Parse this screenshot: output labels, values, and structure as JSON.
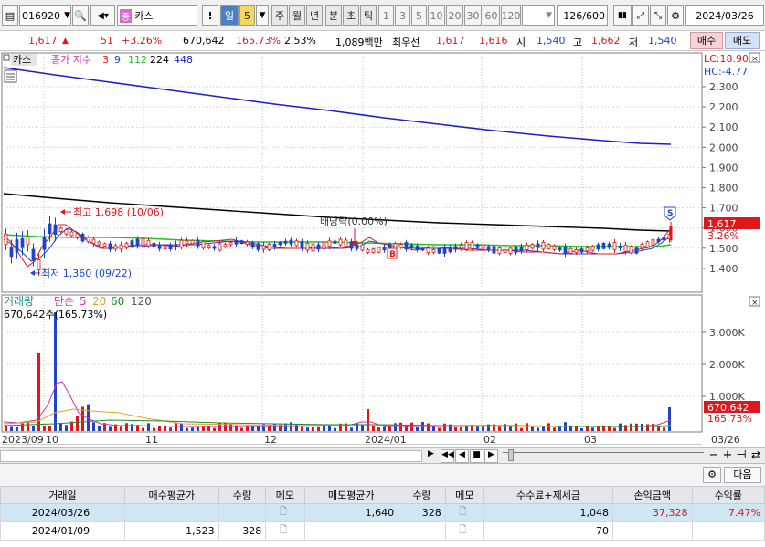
{
  "toolbar": {
    "code": "016920",
    "badge": "종",
    "name": "카스",
    "periods": [
      "일",
      "5",
      "주",
      "월",
      "년",
      "분",
      "초",
      "틱"
    ],
    "intervals": [
      "1",
      "3",
      "5",
      "10",
      "20",
      "30",
      "60",
      "120"
    ],
    "count": "126",
    "total": "/600",
    "date": "2024/03/26"
  },
  "quote": {
    "price": "1,617",
    "change": "51",
    "pct": "+3.26%",
    "volume": "670,642",
    "vol_ratio": "165.73%",
    "turnover": "2.53%",
    "amount": "1,089백만",
    "best_label": "최우선",
    "ask": "1,617",
    "bid": "1,616",
    "open_label": "시",
    "open": "1,540",
    "high_label": "고",
    "high": "1,662",
    "low_label": "저",
    "low": "1,540",
    "buy_button": "매수",
    "sell_button": "매도"
  },
  "price_panel": {
    "stock_label": "카스",
    "ma_label": "종가 지수",
    "ma_periods": [
      "3",
      "9",
      "112",
      "224",
      "448"
    ],
    "lc": "LC:18.90",
    "hc": "HC:-4.77",
    "axis": [
      "2,300",
      "2,200",
      "2,100",
      "2,000",
      "1,900",
      "1,800",
      "1,700",
      "1,600",
      "1,500",
      "1,400"
    ],
    "price_tag": "1,617",
    "pct_tag": "3.26%",
    "high_note": "최고 1,698 (10/06)",
    "low_note": "최저 1,360 (09/22)",
    "dividend_note": "배당락(0.00%)",
    "signal_s": "S",
    "signal_b": "B"
  },
  "volume_panel": {
    "label": "거래량",
    "ma_label": "단순",
    "ma_periods": [
      "5",
      "20",
      "60",
      "120"
    ],
    "current": "670,642주(165.73%)",
    "axis": [
      "3,000K",
      "2,000K",
      "1,000K"
    ],
    "vol_tag": "670,642",
    "pct_tag": "165.73%"
  },
  "time_axis": {
    "labels": [
      "2023/09",
      "10",
      "11",
      "12",
      "2024/01",
      "02",
      "03"
    ],
    "right_label": "03/26"
  },
  "colors": {
    "up": "#e0161b",
    "down": "#1e44c8",
    "ma3": "#e0161b",
    "ma9": "#1e44c8",
    "ma112": "#22c322",
    "ma224": "#000000",
    "ma448": "#1e1ec8"
  },
  "grid": {
    "next_button": "다음",
    "columns": [
      "거래일",
      "매수평균가",
      "수량",
      "메모",
      "매도평균가",
      "수량",
      "메모",
      "수수료+제세금",
      "손익금액",
      "수익률"
    ],
    "rows": [
      [
        "2024/03/26",
        "",
        "",
        "",
        "1,640",
        "328",
        "",
        "1,048",
        "37,328",
        "7.47%"
      ],
      [
        "2024/01/09",
        "1,523",
        "328",
        "",
        "",
        "",
        "",
        "70",
        "",
        ""
      ]
    ]
  }
}
